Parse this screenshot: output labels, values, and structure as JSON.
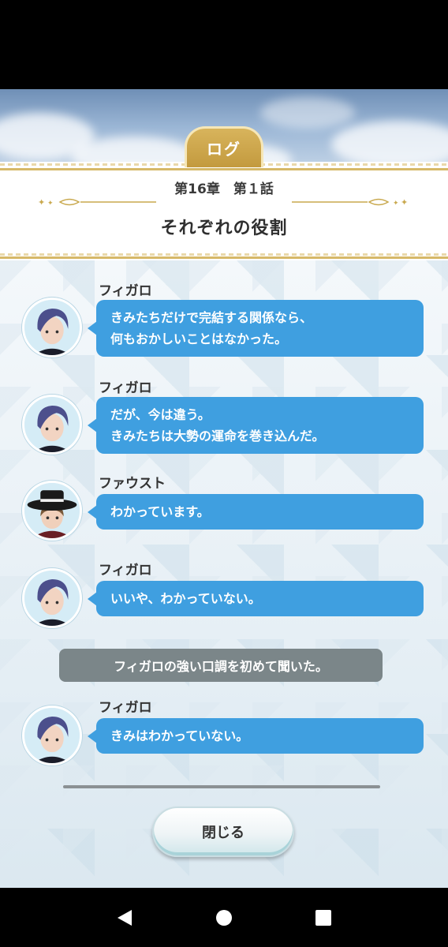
{
  "header": {
    "tab_label": "ログ",
    "chapter": "第16章　第１話",
    "title": "それぞれの役割"
  },
  "entries": [
    {
      "speaker": "フィガロ",
      "avatar": "figaro-avatar",
      "lines": [
        "きみたちだけで完結する関係なら、",
        "何もおかしいことはなかった。"
      ]
    },
    {
      "speaker": "フィガロ",
      "avatar": "figaro-avatar",
      "lines": [
        "だが、今は違う。",
        "きみたちは大勢の運命を巻き込んだ。"
      ]
    },
    {
      "speaker": "ファウスト",
      "avatar": "faust-avatar",
      "lines": [
        "わかっています。"
      ]
    },
    {
      "speaker": "フィガロ",
      "avatar": "figaro-avatar",
      "lines": [
        "いいや、わかっていない。"
      ]
    },
    {
      "speaker": "フィガロ",
      "avatar": "figaro-avatar",
      "lines": [
        "きみはわかっていない。"
      ]
    }
  ],
  "narration": "フィガロの強い口調を初めて聞いた。",
  "close_button": "閉じる",
  "nav": {
    "back": "back-icon",
    "home": "home-icon",
    "recents": "recents-icon"
  },
  "colors": {
    "bubble": "#3f9fe0",
    "gold": "#d6b868",
    "narration": "#7b8689"
  }
}
